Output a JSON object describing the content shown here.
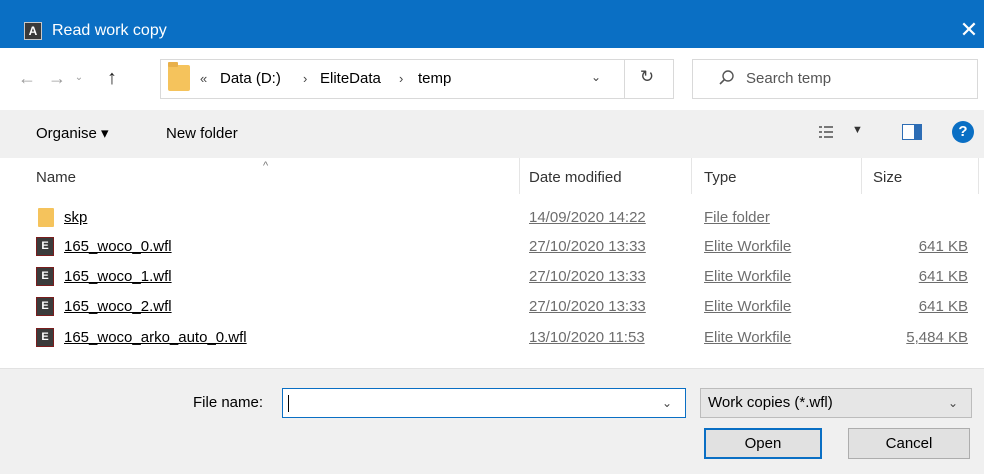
{
  "window": {
    "app_icon_letter": "A",
    "title": "Read work copy",
    "close_glyph": "✕"
  },
  "nav": {
    "back": "←",
    "forward": "→",
    "recent": "⌄",
    "up": "↑"
  },
  "address": {
    "overflow": "«",
    "crumbs": [
      "Data (D:)",
      "EliteData",
      "temp"
    ],
    "separator": "›",
    "dropdown": "⌄",
    "refresh": "↻"
  },
  "search": {
    "placeholder": "Search temp"
  },
  "toolbar": {
    "organise_label": "Organise ▾",
    "new_folder_label": "New folder",
    "view_drop": "▼",
    "help": "?"
  },
  "columns": {
    "name": "Name",
    "date": "Date modified",
    "type": "Type",
    "size": "Size",
    "sort_arrow": "^"
  },
  "files": [
    {
      "name": "skp",
      "date": "14/09/2020 14:22",
      "type": "File folder",
      "size": "",
      "icon": "folder-icon"
    },
    {
      "name": "165_woco_0.wfl",
      "date": "27/10/2020 13:33",
      "type": "Elite Workfile",
      "size": "641 KB",
      "icon": "wfl-icon"
    },
    {
      "name": "165_woco_1.wfl",
      "date": "27/10/2020 13:33",
      "type": "Elite Workfile",
      "size": "641 KB",
      "icon": "wfl-icon"
    },
    {
      "name": "165_woco_2.wfl",
      "date": "27/10/2020 13:33",
      "type": "Elite Workfile",
      "size": "641 KB",
      "icon": "wfl-icon"
    },
    {
      "name": "165_woco_arko_auto_0.wfl",
      "date": "13/10/2020 11:53",
      "type": "Elite Workfile",
      "size": "5,484 KB",
      "icon": "wfl-icon"
    }
  ],
  "wfl_icon_letter": "E",
  "footer": {
    "filename_label": "File name:",
    "filename_value": "",
    "filename_drop": "⌄",
    "filetype": "Work copies (*.wfl)",
    "filetype_drop": "⌄",
    "open_label": "Open",
    "cancel_label": "Cancel"
  },
  "colors": {
    "titlebar": "#0a6fc4",
    "folder": "#f5c35c",
    "accent": "#0a6fc4"
  }
}
